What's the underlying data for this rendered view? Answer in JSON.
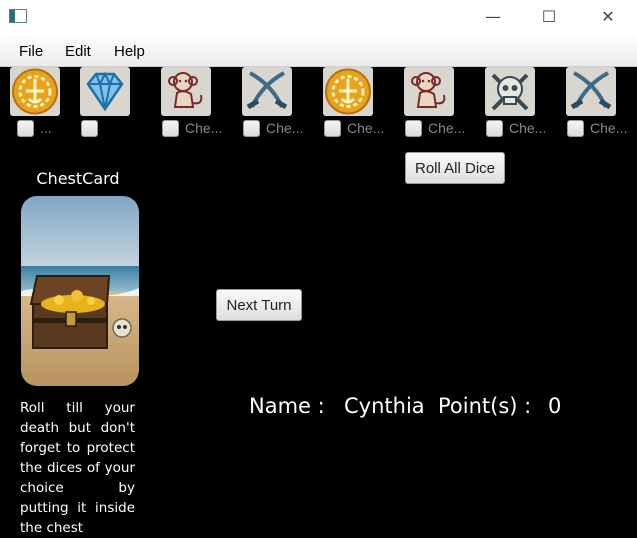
{
  "window": {
    "minimize_glyph": "—",
    "maximize_glyph": "☐",
    "close_glyph": "✕"
  },
  "menu": {
    "items": [
      "File",
      "Edit",
      "Help"
    ]
  },
  "dice": [
    {
      "face": "coin",
      "checkbox_label": "..."
    },
    {
      "face": "diamond",
      "checkbox_label": ""
    },
    {
      "face": "monkey",
      "checkbox_label": "Che..."
    },
    {
      "face": "sabre",
      "checkbox_label": "Che..."
    },
    {
      "face": "coin",
      "checkbox_label": "Che..."
    },
    {
      "face": "monkey",
      "checkbox_label": "Che..."
    },
    {
      "face": "skull",
      "checkbox_label": "Che..."
    },
    {
      "face": "sabre",
      "checkbox_label": "Che..."
    }
  ],
  "buttons": {
    "roll_all": "Roll All Dice",
    "next_turn": "Next Turn"
  },
  "card": {
    "title": "ChestCard",
    "description": "Roll till your death but don't forget to protect the dices of your choice by putting it inside the chest"
  },
  "player": {
    "name_label": "Name :",
    "name": "Cynthia",
    "points_label": "Point(s) :",
    "points": "0"
  },
  "colors": {
    "background": "#000000",
    "coin": "#e8a21c",
    "diamond": "#2f86c7",
    "die_bg": "#d9d6cf"
  }
}
